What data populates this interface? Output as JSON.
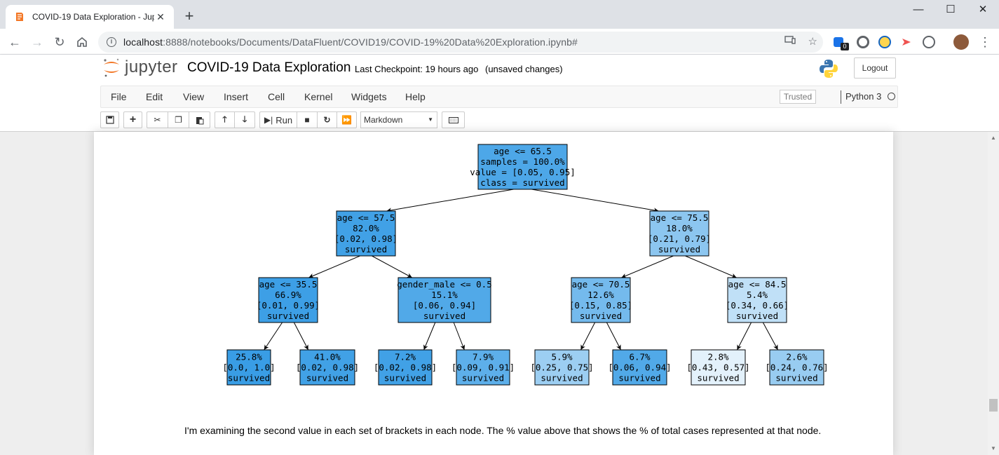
{
  "browser": {
    "tab_title": "COVID-19 Data Exploration - Jup",
    "url_host": "localhost",
    "url_rest": ":8888/notebooks/Documents/DataFluent/COVID19/COVID-19%20Data%20Exploration.ipynb#",
    "extension_badge": "0"
  },
  "jupyter": {
    "logo_text": "jupyter",
    "notebook_name": "COVID-19 Data Exploration",
    "checkpoint": "Last Checkpoint: 19 hours ago",
    "unsaved": "(unsaved changes)",
    "logout_label": "Logout",
    "menu": [
      "File",
      "Edit",
      "View",
      "Insert",
      "Cell",
      "Kernel",
      "Widgets",
      "Help"
    ],
    "trusted_label": "Trusted",
    "kernel_name": "Python 3",
    "run_label": "Run",
    "cell_type": "Markdown"
  },
  "tree": {
    "nodes": [
      {
        "lines": [
          "age <= 65.5",
          "samples = 100.0%",
          "value = [0.05, 0.95]",
          "class = survived"
        ],
        "shade": 0.95
      },
      {
        "lines": [
          "age <= 57.5",
          "82.0%",
          "[0.02, 0.98]",
          "survived"
        ],
        "shade": 0.98
      },
      {
        "lines": [
          "age <= 75.5",
          "18.0%",
          "[0.21, 0.79]",
          "survived"
        ],
        "shade": 0.79
      },
      {
        "lines": [
          "age <= 35.5",
          "66.9%",
          "[0.01, 0.99]",
          "survived"
        ],
        "shade": 0.99
      },
      {
        "lines": [
          "gender_male <= 0.5",
          "15.1%",
          "[0.06, 0.94]",
          "survived"
        ],
        "shade": 0.94
      },
      {
        "lines": [
          "age <= 70.5",
          "12.6%",
          "[0.15, 0.85]",
          "survived"
        ],
        "shade": 0.85
      },
      {
        "lines": [
          "age <= 84.5",
          "5.4%",
          "[0.34, 0.66]",
          "survived"
        ],
        "shade": 0.66
      },
      {
        "lines": [
          "25.8%",
          "[0.0, 1.0]",
          "survived"
        ],
        "shade": 1.0
      },
      {
        "lines": [
          "41.0%",
          "[0.02, 0.98]",
          "survived"
        ],
        "shade": 0.98
      },
      {
        "lines": [
          "7.2%",
          "[0.02, 0.98]",
          "survived"
        ],
        "shade": 0.98
      },
      {
        "lines": [
          "7.9%",
          "[0.09, 0.91]",
          "survived"
        ],
        "shade": 0.91
      },
      {
        "lines": [
          "5.9%",
          "[0.25, 0.75]",
          "survived"
        ],
        "shade": 0.75
      },
      {
        "lines": [
          "6.7%",
          "[0.06, 0.94]",
          "survived"
        ],
        "shade": 0.94
      },
      {
        "lines": [
          "2.8%",
          "[0.43, 0.57]",
          "survived"
        ],
        "shade": 0.57
      },
      {
        "lines": [
          "2.6%",
          "[0.24, 0.76]",
          "survived"
        ],
        "shade": 0.76
      }
    ]
  },
  "markdown_text": "I'm examining the second value in each set of brackets in each node. The % value above that shows the % of total cases represented at that node."
}
